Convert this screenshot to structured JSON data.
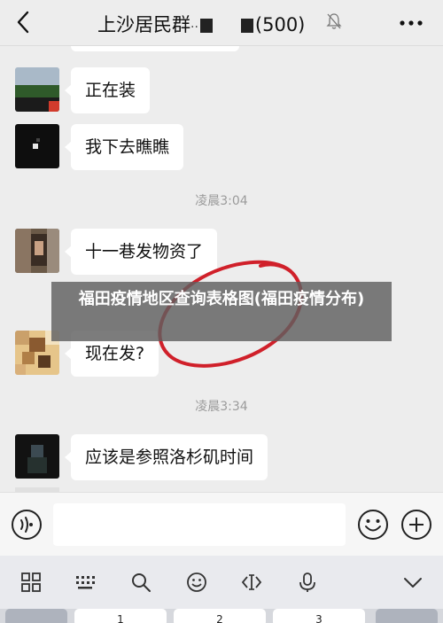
{
  "header": {
    "title_part1": "上沙居民群",
    "title_part2": "(500)",
    "back_icon": "chevron-left-icon",
    "mute_icon": "bell-slash-icon",
    "more_icon": "more-dots-icon"
  },
  "messages": [
    {
      "text": "正在装",
      "avatar": "avatar-icon"
    },
    {
      "text": "我下去瞧瞧",
      "avatar": "avatar-icon"
    },
    {
      "text": "十一巷发物资了",
      "avatar": "avatar-icon"
    },
    {
      "text": "现在发?",
      "avatar": "avatar-icon"
    },
    {
      "text": "应该是参照洛杉矶时间",
      "avatar": "avatar-icon"
    }
  ],
  "timestamps": [
    "凌晨3:04",
    "凌晨3:34"
  ],
  "overlay": {
    "text": "福田疫情地区查询表格图(福田疫情分布)"
  },
  "keyboard_keys": [
    "1",
    "2",
    "3"
  ],
  "colors": {
    "background": "#ededed",
    "bubble": "#ffffff",
    "annotation_circle": "#d0202a"
  }
}
